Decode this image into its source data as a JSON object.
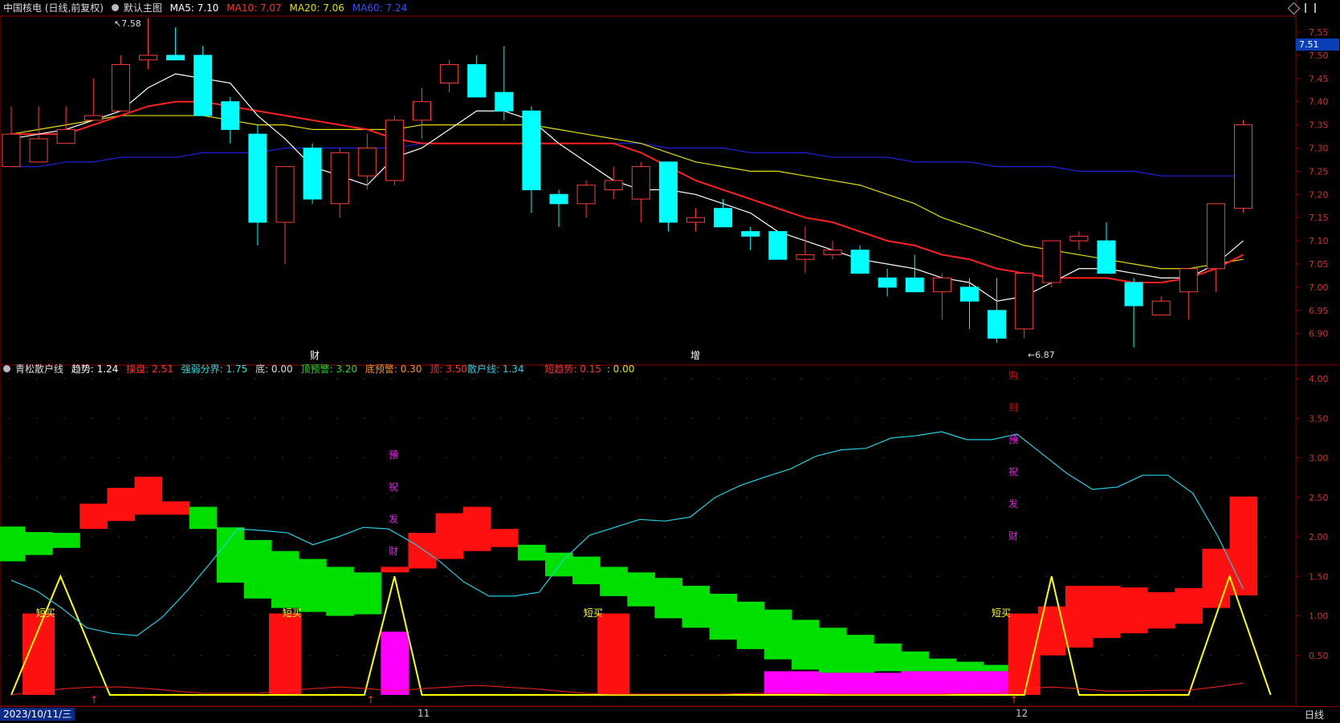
{
  "top_header": {
    "stock": "中国核电 (日线,前复权)",
    "chart_mode": "默认主图",
    "ma5": "MA5: 7.10",
    "ma10": "MA10: 7.07",
    "ma20": "MA20: 7.06",
    "ma60": "MA60: 7.24"
  },
  "bottom_header": {
    "name": "青松散户线",
    "trend": "趋势: 1.24",
    "dip": "操盘: 2.51",
    "divide": "强弱分界: 1.75",
    "bottom": "底: 0.00",
    "top_warn": "顶预警: 3.20",
    "bottom_warn": "底预警: 0.30",
    "top": "顶: 3.50",
    "retail": "散户线: 1.34",
    "short": "短趋势: 0.15",
    "colon_val": ": 0.00"
  },
  "price_axis": [
    "7.55",
    "7.50",
    "7.45",
    "7.40",
    "7.35",
    "7.30",
    "7.25",
    "7.20",
    "7.15",
    "7.10",
    "7.05",
    "7.00",
    "6.95",
    "6.90"
  ],
  "current_price": "7.51",
  "high_label": "7.58",
  "low_label": "6.87",
  "markers": {
    "cai": "财",
    "zeng": "增"
  },
  "ind_axis": [
    "4.00",
    "3.50",
    "3.00",
    "2.50",
    "2.00",
    "1.50",
    "1.00",
    "0.50"
  ],
  "vertical_text_1": [
    "预",
    "祝",
    "发",
    "财"
  ],
  "vertical_text_2": [
    "购",
    "到",
    "预",
    "祝",
    "发",
    "财"
  ],
  "short_buy": "短买",
  "date_label": "2023/10/11/三",
  "month_11": "11",
  "month_12": "12",
  "period": "日线",
  "colors": {
    "up": "#ff3b3b",
    "down": "#00ffff",
    "ma5": "#ffffff",
    "ma10": "#ff2020",
    "ma20": "#e0e000",
    "ma60": "#2020e0",
    "retail": "#20d0e0"
  },
  "chart_data": {
    "type": "candlestick",
    "ohlc": [
      [
        7.26,
        7.39,
        7.26,
        7.33
      ],
      [
        7.27,
        7.39,
        7.27,
        7.32
      ],
      [
        7.31,
        7.39,
        7.31,
        7.34
      ],
      [
        7.36,
        7.45,
        7.36,
        7.37
      ],
      [
        7.38,
        7.5,
        7.38,
        7.48
      ],
      [
        7.49,
        7.58,
        7.47,
        7.5
      ],
      [
        7.5,
        7.56,
        7.5,
        7.49
      ],
      [
        7.5,
        7.52,
        7.37,
        7.37
      ],
      [
        7.4,
        7.41,
        7.31,
        7.34
      ],
      [
        7.33,
        7.35,
        7.09,
        7.14
      ],
      [
        7.14,
        7.26,
        7.05,
        7.26
      ],
      [
        7.3,
        7.31,
        7.18,
        7.19
      ],
      [
        7.18,
        7.3,
        7.15,
        7.29
      ],
      [
        7.24,
        7.33,
        7.21,
        7.3
      ],
      [
        7.23,
        7.37,
        7.22,
        7.36
      ],
      [
        7.36,
        7.43,
        7.32,
        7.4
      ],
      [
        7.44,
        7.49,
        7.42,
        7.48
      ],
      [
        7.48,
        7.5,
        7.41,
        7.41
      ],
      [
        7.42,
        7.52,
        7.36,
        7.38
      ],
      [
        7.38,
        7.39,
        7.16,
        7.21
      ],
      [
        7.2,
        7.21,
        7.13,
        7.18
      ],
      [
        7.18,
        7.23,
        7.15,
        7.22
      ],
      [
        7.21,
        7.26,
        7.19,
        7.23
      ],
      [
        7.19,
        7.27,
        7.14,
        7.26
      ],
      [
        7.27,
        7.27,
        7.12,
        7.14
      ],
      [
        7.14,
        7.17,
        7.12,
        7.15
      ],
      [
        7.17,
        7.19,
        7.14,
        7.13
      ],
      [
        7.12,
        7.13,
        7.08,
        7.11
      ],
      [
        7.12,
        7.12,
        7.06,
        7.06
      ],
      [
        7.06,
        7.13,
        7.03,
        7.07
      ],
      [
        7.07,
        7.1,
        7.06,
        7.08
      ],
      [
        7.08,
        7.09,
        7.03,
        7.03
      ],
      [
        7.02,
        7.04,
        6.98,
        7.0
      ],
      [
        7.02,
        7.07,
        6.99,
        6.99
      ],
      [
        6.99,
        7.03,
        6.93,
        7.02
      ],
      [
        7.0,
        7.02,
        6.91,
        6.97
      ],
      [
        6.95,
        7.02,
        6.88,
        6.89
      ],
      [
        6.91,
        7.03,
        6.89,
        7.03
      ],
      [
        7.01,
        7.1,
        7.0,
        7.1
      ],
      [
        7.1,
        7.12,
        7.08,
        7.11
      ],
      [
        7.1,
        7.14,
        7.03,
        7.03
      ],
      [
        7.01,
        7.02,
        6.87,
        6.96
      ],
      [
        6.94,
        6.98,
        6.94,
        6.97
      ],
      [
        6.99,
        7.04,
        6.93,
        7.04
      ],
      [
        7.04,
        7.18,
        6.99,
        7.18
      ],
      [
        7.17,
        7.36,
        7.16,
        7.35
      ]
    ],
    "ma5": [
      7.32,
      7.33,
      7.34,
      7.36,
      7.38,
      7.43,
      7.46,
      7.45,
      7.44,
      7.37,
      7.32,
      7.26,
      7.24,
      7.22,
      7.28,
      7.3,
      7.34,
      7.38,
      7.38,
      7.36,
      7.31,
      7.27,
      7.23,
      7.21,
      7.21,
      7.2,
      7.18,
      7.16,
      7.12,
      7.1,
      7.08,
      7.06,
      7.05,
      7.04,
      7.02,
      7.01,
      6.97,
      6.98,
      7.01,
      7.04,
      7.04,
      7.03,
      7.02,
      7.02,
      7.05,
      7.1
    ],
    "ma10": [
      7.33,
      7.33,
      7.33,
      7.35,
      7.37,
      7.39,
      7.4,
      7.4,
      7.39,
      7.38,
      7.37,
      7.36,
      7.35,
      7.34,
      7.32,
      7.31,
      7.31,
      7.31,
      7.31,
      7.31,
      7.31,
      7.31,
      7.31,
      7.29,
      7.26,
      7.23,
      7.21,
      7.19,
      7.17,
      7.15,
      7.14,
      7.12,
      7.1,
      7.09,
      7.07,
      7.06,
      7.04,
      7.03,
      7.02,
      7.02,
      7.02,
      7.01,
      7.01,
      7.02,
      7.04,
      7.07
    ],
    "ma20": [
      7.33,
      7.34,
      7.35,
      7.36,
      7.37,
      7.37,
      7.37,
      7.37,
      7.36,
      7.35,
      7.35,
      7.34,
      7.34,
      7.34,
      7.34,
      7.35,
      7.35,
      7.35,
      7.35,
      7.35,
      7.34,
      7.33,
      7.32,
      7.31,
      7.29,
      7.27,
      7.26,
      7.25,
      7.25,
      7.24,
      7.23,
      7.22,
      7.2,
      7.18,
      7.15,
      7.13,
      7.11,
      7.09,
      7.08,
      7.07,
      7.06,
      7.05,
      7.04,
      7.04,
      7.05,
      7.06
    ],
    "ma60": [
      7.26,
      7.26,
      7.27,
      7.27,
      7.28,
      7.28,
      7.28,
      7.29,
      7.29,
      7.29,
      7.3,
      7.3,
      7.3,
      7.3,
      7.3,
      7.31,
      7.31,
      7.31,
      7.31,
      7.31,
      7.31,
      7.31,
      7.31,
      7.31,
      7.3,
      7.3,
      7.3,
      7.29,
      7.29,
      7.29,
      7.28,
      7.28,
      7.28,
      7.27,
      7.27,
      7.27,
      7.26,
      7.26,
      7.26,
      7.25,
      7.25,
      7.25,
      7.24,
      7.24,
      7.24,
      7.24
    ],
    "retail_line": [
      1.45,
      1.32,
      1.1,
      0.85,
      0.78,
      0.75,
      0.98,
      1.32,
      1.7,
      2.1,
      2.08,
      2.05,
      1.9,
      2.0,
      2.12,
      2.1,
      1.92,
      1.7,
      1.43,
      1.25,
      1.25,
      1.3,
      1.72,
      2.02,
      2.12,
      2.22,
      2.2,
      2.25,
      2.5,
      2.65,
      2.76,
      2.86,
      3.02,
      3.1,
      3.12,
      3.25,
      3.28,
      3.33,
      3.23,
      3.23,
      3.3,
      3.05,
      2.8,
      2.6,
      2.63,
      2.78,
      2.78,
      2.55,
      2.0,
      1.34
    ]
  }
}
